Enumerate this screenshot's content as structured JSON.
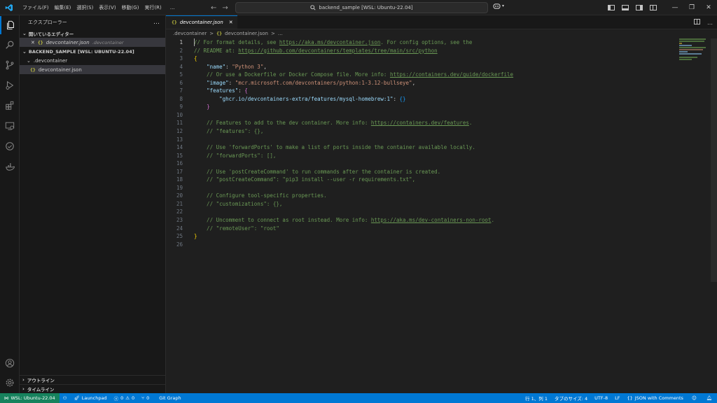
{
  "app": {
    "menu": [
      "ファイル(F)",
      "編集(E)",
      "選択(S)",
      "表示(V)",
      "移動(G)",
      "実行(R)",
      "…"
    ],
    "command_center": "backend_sample [WSL: Ubuntu-22.04]"
  },
  "sidebar": {
    "title": "エクスプローラー",
    "more": "…",
    "open_editors_label": "開いているエディター",
    "open_editor": {
      "close": "✕",
      "icon": "{}",
      "name": "devcontainer.json",
      "folder": ".devcontainer"
    },
    "workspace_label": "BACKEND_SAMPLE [WSL: UBUNTU-22.04]",
    "folder": ".devcontainer",
    "file": {
      "icon": "{}",
      "name": "devcontainer.json"
    },
    "outline_label": "アウトライン",
    "timeline_label": "タイムライン"
  },
  "editor": {
    "tab": {
      "icon": "{}",
      "name": "devcontainer.json",
      "close": "✕"
    },
    "breadcrumb": {
      "folder": ".devcontainer",
      "sep": ">",
      "file": "devcontainer.json",
      "more": "…"
    },
    "current_line": 1,
    "lines": [
      [
        {
          "t": "// For format details, see ",
          "c": "com"
        },
        {
          "t": "https://aka.ms/devcontainer.json",
          "c": "link"
        },
        {
          "t": ". For config options, see the",
          "c": "com"
        }
      ],
      [
        {
          "t": "// README at: ",
          "c": "com"
        },
        {
          "t": "https://github.com/devcontainers/templates/tree/main/src/python",
          "c": "link"
        }
      ],
      [
        {
          "t": "{",
          "c": "b1"
        }
      ],
      [
        {
          "t": "    ",
          "c": "p"
        },
        {
          "t": "\"name\"",
          "c": "key"
        },
        {
          "t": ": ",
          "c": "p"
        },
        {
          "t": "\"Python 3\"",
          "c": "str"
        },
        {
          "t": ",",
          "c": "p"
        }
      ],
      [
        {
          "t": "    // Or use a Dockerfile or Docker Compose file. More info: ",
          "c": "com"
        },
        {
          "t": "https://containers.dev/guide/dockerfile",
          "c": "link"
        }
      ],
      [
        {
          "t": "    ",
          "c": "p"
        },
        {
          "t": "\"image\"",
          "c": "key"
        },
        {
          "t": ": ",
          "c": "p"
        },
        {
          "t": "\"mcr.microsoft.com/devcontainers/python:1-3.12-bullseye\"",
          "c": "str"
        },
        {
          "t": ",",
          "c": "p"
        }
      ],
      [
        {
          "t": "    ",
          "c": "p"
        },
        {
          "t": "\"features\"",
          "c": "key"
        },
        {
          "t": ": ",
          "c": "p"
        },
        {
          "t": "{",
          "c": "b2"
        }
      ],
      [
        {
          "t": "        ",
          "c": "p"
        },
        {
          "t": "\"ghcr.io/devcontainers-extra/features/mysql-homebrew:1\"",
          "c": "key"
        },
        {
          "t": ": ",
          "c": "p"
        },
        {
          "t": "{}",
          "c": "b3"
        }
      ],
      [
        {
          "t": "    ",
          "c": "p"
        },
        {
          "t": "}",
          "c": "b2"
        }
      ],
      [],
      [
        {
          "t": "    // Features to add to the dev container. More info: ",
          "c": "com"
        },
        {
          "t": "https://containers.dev/features",
          "c": "link"
        },
        {
          "t": ".",
          "c": "com"
        }
      ],
      [
        {
          "t": "    // \"features\": {},",
          "c": "com"
        }
      ],
      [],
      [
        {
          "t": "    // Use 'forwardPorts' to make a list of ports inside the container available locally.",
          "c": "com"
        }
      ],
      [
        {
          "t": "    // \"forwardPorts\": [],",
          "c": "com"
        }
      ],
      [],
      [
        {
          "t": "    // Use 'postCreateCommand' to run commands after the container is created.",
          "c": "com"
        }
      ],
      [
        {
          "t": "    // \"postCreateCommand\": \"pip3 install --user -r requirements.txt\",",
          "c": "com"
        }
      ],
      [],
      [
        {
          "t": "    // Configure tool-specific properties.",
          "c": "com"
        }
      ],
      [
        {
          "t": "    // \"customizations\": {},",
          "c": "com"
        }
      ],
      [],
      [
        {
          "t": "    // Uncomment to connect as root instead. More info: ",
          "c": "com"
        },
        {
          "t": "https://aka.ms/dev-containers-non-root",
          "c": "link"
        },
        {
          "t": ".",
          "c": "com"
        }
      ],
      [
        {
          "t": "    // \"remoteUser\": \"root\"",
          "c": "com"
        }
      ],
      [
        {
          "t": "}",
          "c": "b1"
        }
      ],
      []
    ]
  },
  "status": {
    "remote": "WSL: Ubuntu-22.04",
    "launchpad": "Launchpad",
    "errors": "0",
    "warnings": "0",
    "ports": "0",
    "git_graph": "Git Graph",
    "position": "行 1、列 1",
    "tab_size": "タブのサイズ: 4",
    "encoding": "UTF-8",
    "eol": "LF",
    "language": "JSON with Comments"
  },
  "colors": {
    "accent": "#0078d4",
    "remote": "#16825d",
    "vscode_logo": "#23a9f2"
  }
}
